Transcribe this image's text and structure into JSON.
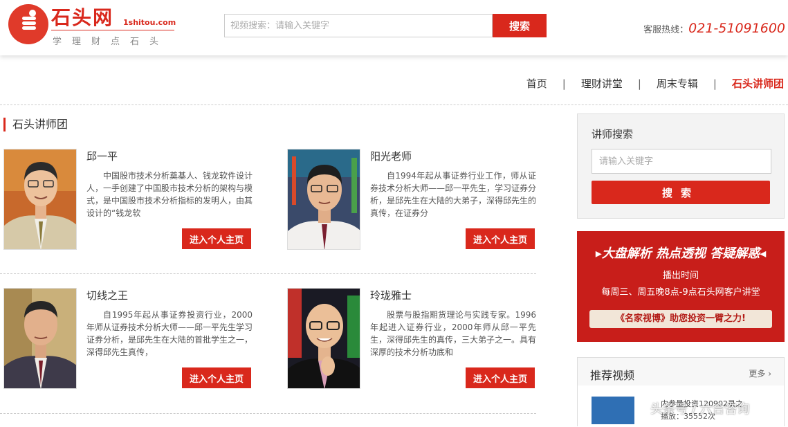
{
  "header": {
    "logo_title": "石头网",
    "logo_domain": "1shitou.com",
    "logo_slogan": "学理财点石头",
    "search_placeholder": "视频搜索：请输入关键字",
    "search_button": "搜索",
    "hotline_label": "客服热线：",
    "hotline_number": "021-51091600"
  },
  "nav": {
    "items": [
      {
        "label": "首页"
      },
      {
        "label": "理财讲堂"
      },
      {
        "label": "周末专辑"
      },
      {
        "label": "石头讲师团",
        "active": true
      }
    ],
    "separator": "|"
  },
  "section": {
    "title": "石头讲师团"
  },
  "lecturers": [
    {
      "name": "邱一平",
      "intro": "中国股市技术分析奠基人、钱龙软件设计人，一手创建了中国股市技术分析的架构与模式，是中国股市技术分析指标的发明人，由其设计的“钱龙软",
      "button": "进入个人主页"
    },
    {
      "name": "阳光老师",
      "intro": "自1994年起从事证券行业工作，师从证券技术分析大师——邱一平先生，学习证券分析，是邱先生在大陆的大弟子，深得邱先生的真传，在证券分",
      "button": "进入个人主页"
    },
    {
      "name": "切线之王",
      "intro": "自1995年起从事证券投资行业，2000年师从证券技术分析大师——邱一平先生学习证券分析，是邱先生在大陆的首批学生之一，深得邱先生真传，",
      "button": "进入个人主页"
    },
    {
      "name": "玲珑雅士",
      "intro": "股票与股指期货理论与实践专家。1996年起进入证券行业，2000年师从邱一平先生，深得邱先生的真传，三大弟子之一。具有深厚的技术分析功底和",
      "button": "进入个人主页"
    }
  ],
  "sidebar": {
    "search_title": "讲师搜索",
    "search_placeholder": "请输入关键字",
    "search_button": "搜索",
    "banner": {
      "line1": "▸大盘解析 热点透视 答疑解惑◂",
      "line2": "播出时间",
      "line3": "每周三、周五晚8点-9点石头网客户讲堂",
      "line4": "《名家视博》助您投资一臂之力!"
    },
    "recommend": {
      "title": "推荐视频",
      "more": "更多 ›",
      "video_title": "内参量投资120902录之",
      "video_plays": "播放：35552次"
    }
  },
  "watermark": "头条号 / 六合咨询",
  "colors": {
    "accent": "#d9281c"
  }
}
